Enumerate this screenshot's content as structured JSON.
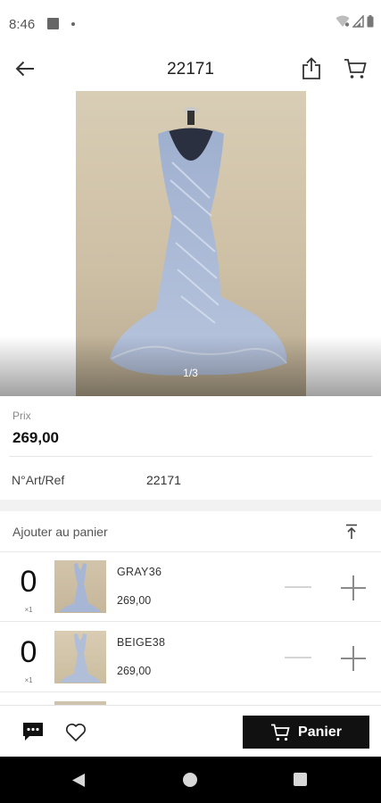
{
  "status_bar": {
    "time": "8:46",
    "icons": [
      "media-icon",
      "dot-icon",
      "wifi-icon",
      "signal-icon",
      "battery-icon"
    ]
  },
  "app_bar": {
    "title": "22171",
    "icons": [
      "back-arrow-icon",
      "share-icon",
      "cart-icon"
    ]
  },
  "gallery": {
    "pager": "1/3",
    "current_page": 1,
    "total_pages": 3
  },
  "product": {
    "price_label": "Prix",
    "price": "269,00",
    "ref_label": "N°Art/Ref",
    "ref_value": "22171"
  },
  "cart_section": {
    "header": "Ajouter au panier",
    "variants": [
      {
        "quantity": "0",
        "step": "×1",
        "name": "GRAY36",
        "price": "269,00"
      },
      {
        "quantity": "0",
        "step": "×1",
        "name": "BEIGE38",
        "price": "269,00"
      }
    ]
  },
  "bottom_bar": {
    "panier_label": "Panier",
    "icons": [
      "chat-icon",
      "heart-icon",
      "cart-icon"
    ]
  },
  "colors": {
    "accent": "#111111",
    "background": "#f2f2f2",
    "dress": "#a9b8d6",
    "backdrop": "#d2c4aa"
  }
}
